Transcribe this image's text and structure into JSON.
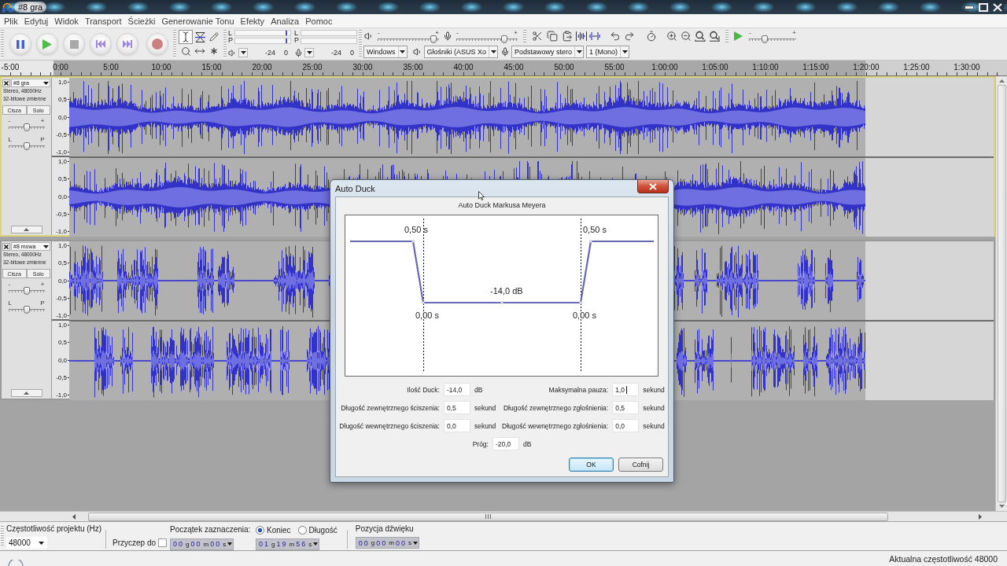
{
  "window": {
    "title": "#8 gra"
  },
  "menu": [
    "Plik",
    "Edytuj",
    "Widok",
    "Transport",
    "Ścieżki",
    "Generowanie Tonu",
    "Efekty",
    "Analiza",
    "Pomoc"
  ],
  "tools": [
    {
      "kind": "select",
      "selected": true
    },
    {
      "kind": "envelope",
      "selected": false
    },
    {
      "kind": "draw",
      "selected": false
    },
    {
      "kind": "zoom",
      "selected": false
    },
    {
      "kind": "timeshift",
      "selected": false
    },
    {
      "kind": "multi",
      "selected": false
    }
  ],
  "meters": [
    {
      "kind": "playback",
      "channels": [
        {
          "label": "L",
          "level": 0.94
        },
        {
          "label": "P",
          "level": 0.94
        }
      ],
      "scale": [
        "-24",
        "0"
      ]
    },
    {
      "kind": "recording",
      "channels": [
        {
          "label": "L"
        },
        {
          "label": "P"
        }
      ],
      "scale": [
        "-24",
        "0"
      ]
    }
  ],
  "mixer": [
    {
      "kind": "output",
      "level": 0.96,
      "min_label": "-",
      "max_label": "+"
    },
    {
      "kind": "input",
      "level": 0.82,
      "min_label": "-",
      "max_label": "+"
    }
  ],
  "play_at_speed": {
    "level": 0.3,
    "min_label": "-",
    "max_label": "+"
  },
  "devices": [
    {
      "kind": "host",
      "value": "Windows"
    },
    {
      "kind": "output",
      "value": "Głośniki (ASUS Xo"
    },
    {
      "kind": "input",
      "value": "Podstawowy stero"
    },
    {
      "kind": "channels",
      "value": "1 (Mono)"
    }
  ],
  "timeline": {
    "labels": [
      "-5:00",
      "0:00",
      "5:00",
      "10:00",
      "15:00",
      "20:00",
      "25:00",
      "30:00",
      "35:00",
      "40:00",
      "45:00",
      "50:00",
      "55:00",
      "1:00:00",
      "1:05:00",
      "1:10:00",
      "1:15:00",
      "1:20:00",
      "1:25:00",
      "1:30:00"
    ]
  },
  "tracks": [
    {
      "name": "#8 gra",
      "focused": true,
      "format": "Stereo, 48000Hz",
      "sample_format": "32-bitowe zmienne",
      "buttons": [
        {
          "label": "Cisza",
          "on": false
        },
        {
          "label": "Solo",
          "on": false
        }
      ],
      "gain": {
        "level": 0.5,
        "min_label": "-",
        "max_label": "+"
      },
      "pan": {
        "level": 0.5,
        "min_label": "L",
        "max_label": "P"
      },
      "channels": [
        {
          "scale": [
            "1,0",
            "0,5",
            "0,0",
            "-0,5",
            "-1,0"
          ]
        },
        {
          "scale": [
            "1,0",
            "0,5",
            "0,0",
            "-0,5",
            "-1,0"
          ]
        }
      ]
    },
    {
      "name": "#8 mowa",
      "focused": false,
      "format": "Stereo, 48000Hz",
      "sample_format": "32-bitowe zmienne",
      "buttons": [
        {
          "label": "Cisza",
          "on": false
        },
        {
          "label": "Solo",
          "on": false
        }
      ],
      "gain": {
        "level": 0.5,
        "min_label": "-",
        "max_label": "+"
      },
      "pan": {
        "level": 0.5,
        "min_label": "L",
        "max_label": "P"
      },
      "channels": [
        {
          "scale": [
            "1,0",
            "0,5",
            "0,0",
            "-0,5",
            "-1,0"
          ]
        },
        {
          "scale": [
            "1,0",
            "0,5",
            "0,0",
            "-0,5",
            "-1,0"
          ]
        }
      ]
    }
  ],
  "dialog": {
    "title": "Auto Duck",
    "subtitle": "Auto Duck Markusa Meyera",
    "graph": {
      "labels": [
        {
          "kind": "outer_fade_down",
          "text": "0,50 s"
        },
        {
          "kind": "outer_fade_up",
          "text": "0,50 s"
        },
        {
          "kind": "duck_amount",
          "text": "-14,0 dB"
        },
        {
          "kind": "inner_fade_down",
          "text": "0,00 s"
        },
        {
          "kind": "inner_fade_up",
          "text": "0,00 s"
        }
      ]
    },
    "rows": [
      [
        {
          "label": "Ilość Duck:",
          "value": "-14,0",
          "unit": "dB",
          "focused": false
        },
        {
          "label": "Maksymalna pauza:",
          "value": "1,0",
          "unit": "sekund",
          "focused": true
        }
      ],
      [
        {
          "label": "Długość zewnętrznego ściszenia:",
          "value": "0,5",
          "unit": "sekund",
          "focused": false
        },
        {
          "label": "Długość zewnętrznego zgłośnienia:",
          "value": "0,5",
          "unit": "sekund",
          "focused": false
        }
      ],
      [
        {
          "label": "Długość wewnętrznego ściszenia:",
          "value": "0,0",
          "unit": "sekund",
          "focused": false
        },
        {
          "label": "Długość wewnętrznego zgłośnienia:",
          "value": "0,0",
          "unit": "sekund",
          "focused": false
        }
      ],
      [
        {
          "label": "Próg:",
          "value": "-20,0",
          "unit": "dB",
          "focused": false
        }
      ]
    ],
    "buttons": [
      {
        "label": "OK",
        "default": true
      },
      {
        "label": "Cofnij",
        "default": false
      }
    ]
  },
  "selection_bar": {
    "project_rate": {
      "label": "Częstotliwość projektu (Hz)",
      "value": "48000"
    },
    "snap": {
      "label": "Przyczep do",
      "checked": false
    },
    "selection_start": {
      "label": "Początek zaznaczenia:",
      "value": "00 g 00 m 00 s"
    },
    "end_mode": [
      {
        "label": "Koniec",
        "selected": true
      },
      {
        "label": "Długość",
        "selected": false
      }
    ],
    "selection_end": {
      "value": "01 g 19 m 56 s"
    },
    "position": {
      "label": "Pozycja dźwięku",
      "value": "00 g 00 m 00 s"
    }
  },
  "status_bar": {
    "text": "Aktualna częstotliwość 48000"
  }
}
